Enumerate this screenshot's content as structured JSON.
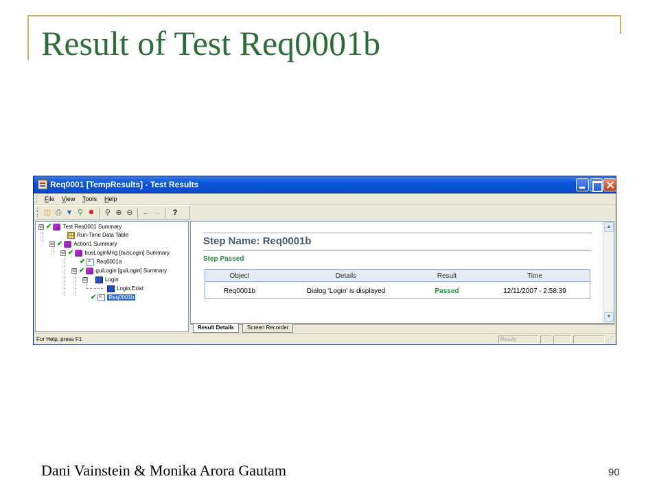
{
  "slide": {
    "title": "Result of Test Req0001b",
    "footer": "Dani Vainstein & Monika Arora Gautam",
    "page_number": "90"
  },
  "window": {
    "title": "Req0001 [TempResults] - Test Results",
    "menu": [
      "File",
      "View",
      "Tools",
      "Help"
    ],
    "toolbar_icons": [
      "open-icon",
      "print-icon",
      "filter-icon",
      "search-icon",
      "bug-icon",
      "find-icon",
      "zoom-in-icon",
      "zoom-out-icon",
      "back-icon",
      "forward-icon",
      "help-icon"
    ],
    "help_symbol": "?",
    "tree": [
      {
        "label": "Test Req0001 Summary",
        "icon": "summary-icon",
        "checked": true,
        "toggle": "⊟"
      },
      {
        "label": "Run-Time Data Table",
        "icon": "table-icon",
        "checked": false
      },
      {
        "label": "Action1 Summary",
        "icon": "summary-icon",
        "checked": true,
        "toggle": "⊟"
      },
      {
        "label": "busLoginMng [busLogin] Summary",
        "icon": "summary-icon",
        "checked": true,
        "toggle": "⊟"
      },
      {
        "label": "Req0001a",
        "icon": "step-icon",
        "checked": true
      },
      {
        "label": "guiLogin [guiLogin] Summary",
        "icon": "summary-icon",
        "checked": true,
        "toggle": "⊟"
      },
      {
        "label": "Login",
        "icon": "object-icon",
        "checked": false,
        "toggle": "⊟"
      },
      {
        "label": "Login.Exist",
        "icon": "object-icon",
        "checked": false
      },
      {
        "label": "Req0001b",
        "icon": "step-icon",
        "checked": true,
        "selected": true
      }
    ],
    "details": {
      "step_name": "Step Name: Req0001b",
      "status": "Step Passed",
      "columns": [
        "Object",
        "Details",
        "Result",
        "Time"
      ],
      "rows": [
        {
          "object": "Req0001b",
          "details": "Dialog 'Login' is displayed",
          "result": "Passed",
          "time": "12/11/2007 - 2:58:39"
        }
      ]
    },
    "tabs": [
      "Result Details",
      "Screen Recorder"
    ],
    "status_bar": {
      "text": "For Help, press F1",
      "ready": "Ready"
    }
  }
}
